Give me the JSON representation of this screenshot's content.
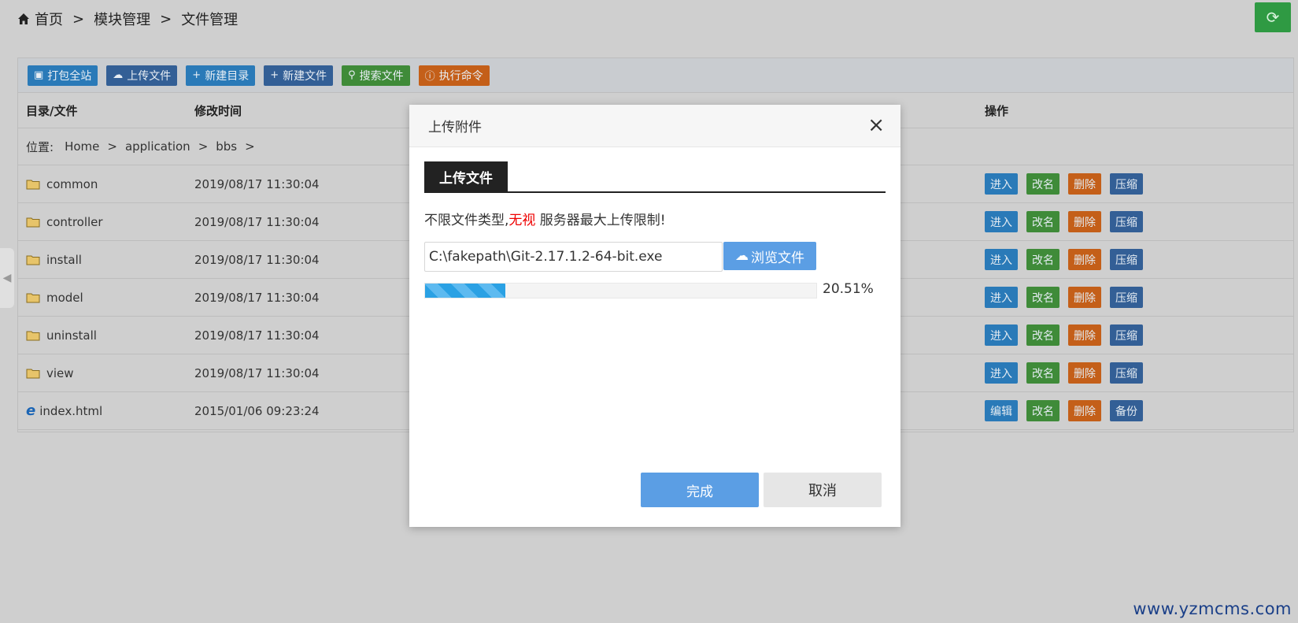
{
  "breadcrumb": {
    "home": "首页",
    "sep": ">",
    "module": "模块管理",
    "current": "文件管理"
  },
  "toolbar": {
    "pack_site": "打包全站",
    "upload_file": "上传文件",
    "new_dir": "新建目录",
    "new_file": "新建文件",
    "search_file": "搜索文件",
    "exec_cmd": "执行命令"
  },
  "table": {
    "headers": {
      "name": "目录/文件",
      "time": "修改时间",
      "ops": "操作"
    },
    "location": {
      "label": "位置:",
      "path": [
        "Home",
        "application",
        "bbs"
      ],
      "sep": ">"
    },
    "rows": [
      {
        "name": "common",
        "time": "2019/08/17 11:30:04",
        "type": "folder",
        "ops": [
          "进入",
          "改名",
          "删除",
          "压缩"
        ]
      },
      {
        "name": "controller",
        "time": "2019/08/17 11:30:04",
        "type": "folder",
        "ops": [
          "进入",
          "改名",
          "删除",
          "压缩"
        ]
      },
      {
        "name": "install",
        "time": "2019/08/17 11:30:04",
        "type": "folder",
        "ops": [
          "进入",
          "改名",
          "删除",
          "压缩"
        ]
      },
      {
        "name": "model",
        "time": "2019/08/17 11:30:04",
        "type": "folder",
        "ops": [
          "进入",
          "改名",
          "删除",
          "压缩"
        ]
      },
      {
        "name": "uninstall",
        "time": "2019/08/17 11:30:04",
        "type": "folder",
        "ops": [
          "进入",
          "改名",
          "删除",
          "压缩"
        ]
      },
      {
        "name": "view",
        "time": "2019/08/17 11:30:04",
        "type": "folder",
        "ops": [
          "进入",
          "改名",
          "删除",
          "压缩"
        ]
      },
      {
        "name": "index.html",
        "time": "2015/01/06 09:23:24",
        "type": "html",
        "ops": [
          "编辑",
          "改名",
          "删除",
          "备份"
        ]
      }
    ]
  },
  "modal": {
    "title": "上传附件",
    "close": "×",
    "tab": "上传文件",
    "notice_pre": "不限文件类型,",
    "notice_red": "无视",
    "notice_post": " 服务器最大上传限制!",
    "file_value": "C:\\fakepath\\Git-2.17.1.2-64-bit.exe",
    "browse_label": "浏览文件",
    "progress_percent": 20.51,
    "progress_text": "20.51%",
    "done_label": "完成",
    "cancel_label": "取消"
  },
  "watermark": "www.yzmcms.com",
  "colors": {
    "blue": "#2a7ab8",
    "navy": "#335f96",
    "green": "#3f8b39",
    "orange": "#c45f19",
    "accent": "#5b9ee4"
  }
}
